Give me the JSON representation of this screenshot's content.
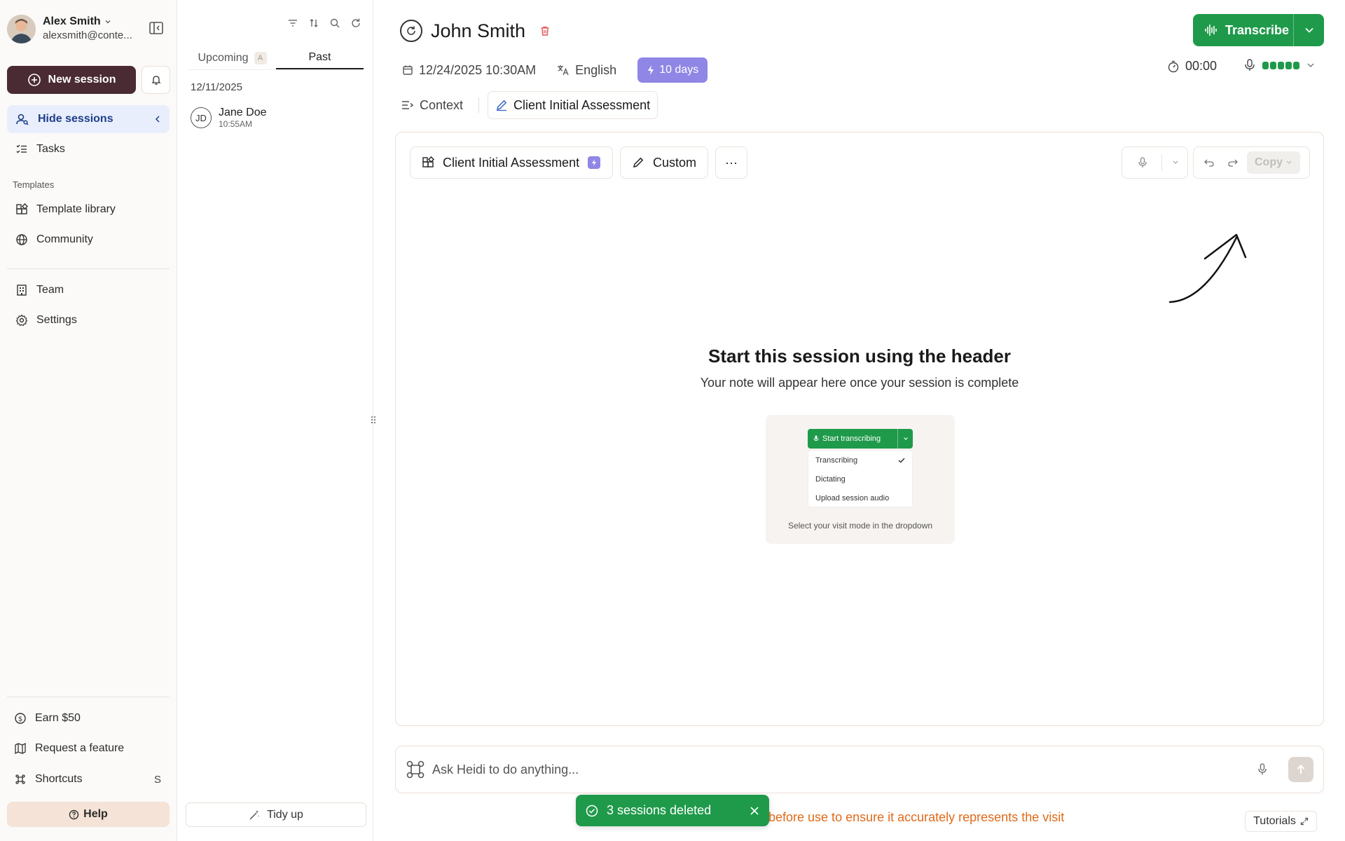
{
  "user": {
    "name": "Alex Smith",
    "email": "alexsmith@conte..."
  },
  "sidebar": {
    "new_session_label": "New session",
    "hide_sessions_label": "Hide sessions",
    "tasks_label": "Tasks",
    "templates_heading": "Templates",
    "template_library_label": "Template library",
    "community_label": "Community",
    "team_label": "Team",
    "settings_label": "Settings",
    "earn_label": "Earn $50",
    "request_feature_label": "Request a feature",
    "shortcuts_label": "Shortcuts",
    "shortcuts_key": "S",
    "help_label": "Help"
  },
  "sessions": {
    "tabs": [
      {
        "label": "Upcoming",
        "badge": "A"
      },
      {
        "label": "Past"
      }
    ],
    "date_heading": "12/11/2025",
    "items": [
      {
        "initials": "JD",
        "name": "Jane Doe",
        "time": "10:55AM"
      }
    ],
    "tidy_label": "Tidy up"
  },
  "header": {
    "patient_name": "John Smith",
    "datetime": "12/24/2025 10:30AM",
    "language": "English",
    "trial_label": "10 days",
    "transcribe_label": "Transcribe",
    "timer": "00:00",
    "mic_level_bars": 5
  },
  "note_tabs": [
    {
      "label": "Context"
    },
    {
      "label": "Client Initial Assessment"
    }
  ],
  "toolbar": {
    "template_label": "Client Initial Assessment",
    "custom_label": "Custom",
    "more_label": "···",
    "copy_label": "Copy"
  },
  "empty_state": {
    "title": "Start this session using the header",
    "subtitle": "Your note will appear here once your session is complete",
    "tip_button": "Start transcribing",
    "tip_options": [
      "Transcribing",
      "Dictating",
      "Upload session audio"
    ],
    "tip_caption": "Select your visit mode in the dropdown"
  },
  "ask": {
    "placeholder": "Ask Heidi to do anything..."
  },
  "footer": {
    "disclaimer": "before use to ensure it accurately represents the visit",
    "tutorials_label": "Tutorials"
  },
  "toast": {
    "message": "3 sessions deleted"
  },
  "colors": {
    "brand_dark": "#4a2b33",
    "green": "#1f9a4a",
    "purple": "#8f86e6",
    "warning": "#e06a1a"
  }
}
